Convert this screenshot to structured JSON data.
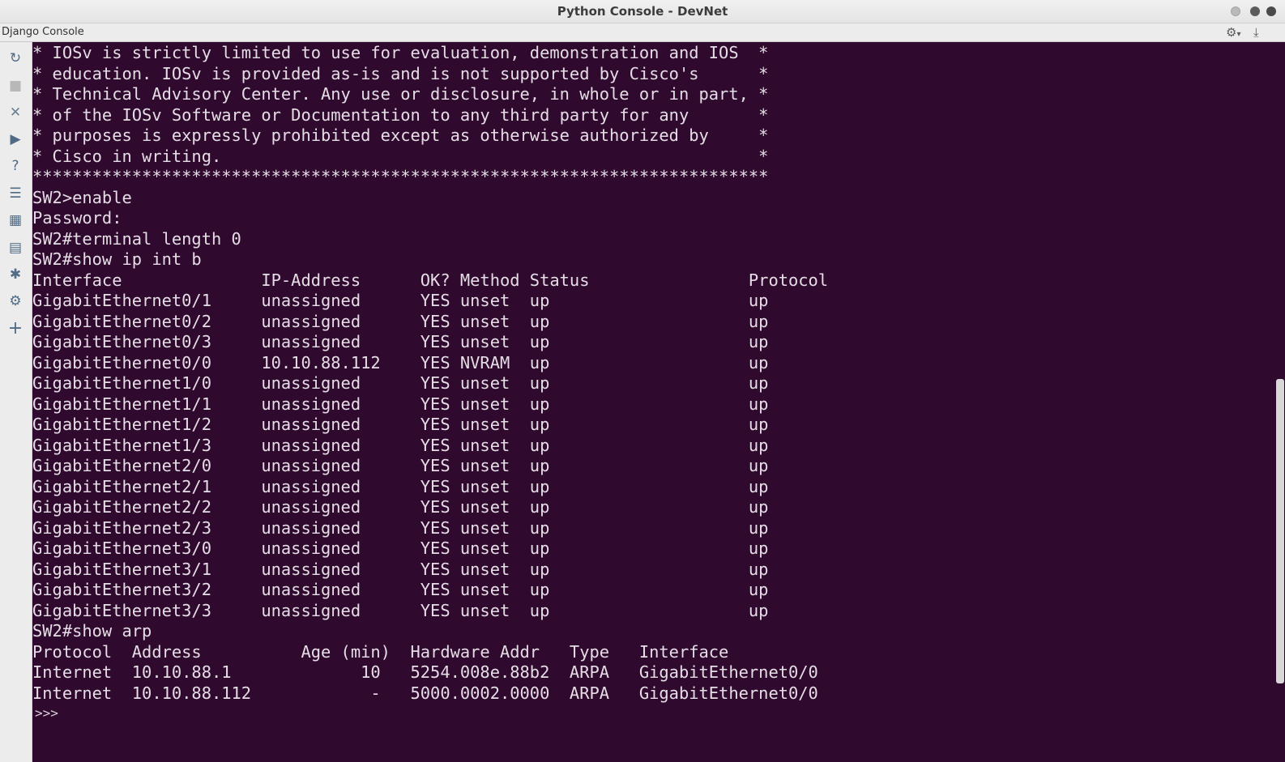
{
  "window": {
    "title": "Python Console - DevNet"
  },
  "tab": {
    "label": "Django Console"
  },
  "icons": {
    "settings": "gear-icon",
    "download": "download-icon",
    "side": [
      "rerun-icon",
      "stop-icon",
      "close-icon",
      "run-icon",
      "help-icon",
      "settings-list-icon",
      "variables-icon",
      "history-icon",
      "debug-icon",
      "settings-icon",
      "add-icon"
    ]
  },
  "colors": {
    "console_bg": "#300a2e",
    "console_fg": "#e5dde5"
  },
  "console": {
    "lines": [
      "* IOSv is strictly limited to use for evaluation, demonstration and IOS  *",
      "* education. IOSv is provided as-is and is not supported by Cisco's      *",
      "* Technical Advisory Center. Any use or disclosure, in whole or in part, *",
      "* of the IOSv Software or Documentation to any third party for any       *",
      "* purposes is expressly prohibited except as otherwise authorized by     *",
      "* Cisco in writing.                                                      *",
      "**************************************************************************",
      "SW2>enable",
      "Password:",
      "SW2#terminal length 0",
      "SW2#show ip int b",
      "Interface              IP-Address      OK? Method Status                Protocol",
      "GigabitEthernet0/1     unassigned      YES unset  up                    up",
      "GigabitEthernet0/2     unassigned      YES unset  up                    up",
      "GigabitEthernet0/3     unassigned      YES unset  up                    up",
      "GigabitEthernet0/0     10.10.88.112    YES NVRAM  up                    up",
      "GigabitEthernet1/0     unassigned      YES unset  up                    up",
      "GigabitEthernet1/1     unassigned      YES unset  up                    up",
      "GigabitEthernet1/2     unassigned      YES unset  up                    up",
      "GigabitEthernet1/3     unassigned      YES unset  up                    up",
      "GigabitEthernet2/0     unassigned      YES unset  up                    up",
      "GigabitEthernet2/1     unassigned      YES unset  up                    up",
      "GigabitEthernet2/2     unassigned      YES unset  up                    up",
      "GigabitEthernet2/3     unassigned      YES unset  up                    up",
      "GigabitEthernet3/0     unassigned      YES unset  up                    up",
      "GigabitEthernet3/1     unassigned      YES unset  up                    up",
      "GigabitEthernet3/2     unassigned      YES unset  up                    up",
      "GigabitEthernet3/3     unassigned      YES unset  up                    up",
      "SW2#show arp",
      "Protocol  Address          Age (min)  Hardware Addr   Type   Interface",
      "Internet  10.10.88.1             10   5254.008e.88b2  ARPA   GigabitEthernet0/0",
      "Internet  10.10.88.112            -   5000.0002.0000  ARPA   GigabitEthernet0/0"
    ],
    "prompt": ">>>"
  }
}
